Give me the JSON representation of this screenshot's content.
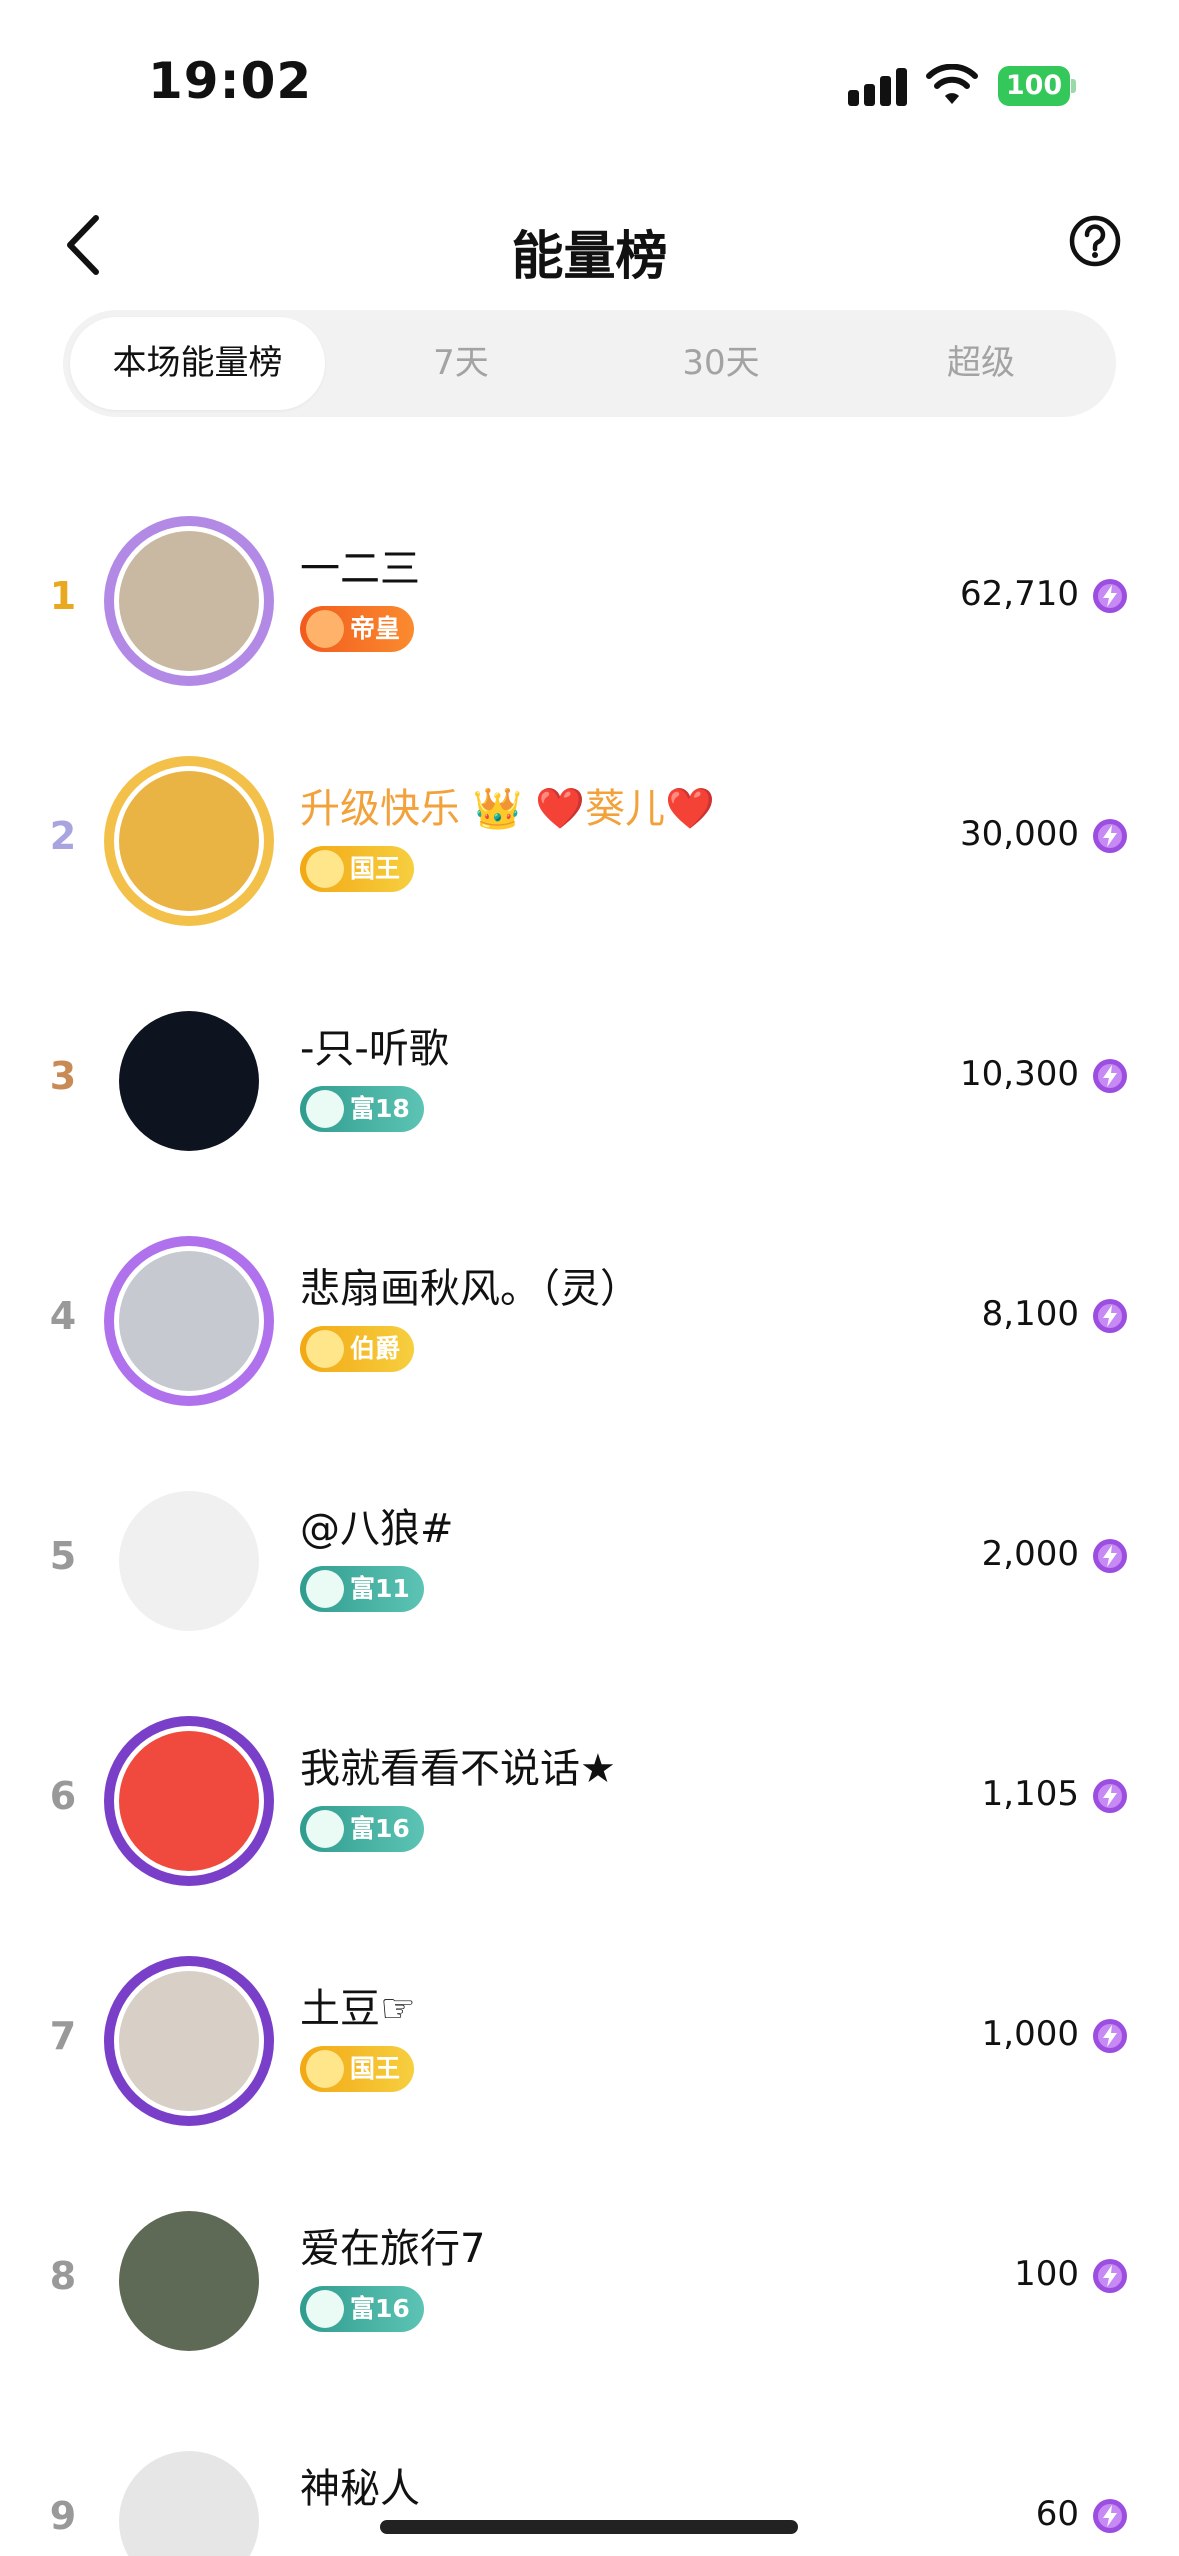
{
  "status_bar": {
    "time": "19:02",
    "battery": "100"
  },
  "nav": {
    "title": "能量榜"
  },
  "tabs": [
    {
      "label": "本场能量榜",
      "active": true
    },
    {
      "label": "7天",
      "active": false
    },
    {
      "label": "30天",
      "active": false
    },
    {
      "label": "超级",
      "active": false
    }
  ],
  "rows": [
    {
      "rank": "1",
      "rank_color": "#e8a920",
      "name": "一二三",
      "badge": "帝皇",
      "badge_style": "orange",
      "score": "62,710",
      "avatar_color": "#c9b9a2",
      "frame_color": "#b28ae6"
    },
    {
      "rank": "2",
      "rank_color": "#a8a4e0",
      "name": "升级快乐 👑 ❤️葵儿❤️",
      "name_color": "#f3a23b",
      "badge": "国王",
      "badge_style": "gold",
      "score": "30,000",
      "avatar_color": "#e9b443",
      "frame_color": "#f3c04a"
    },
    {
      "rank": "3",
      "rank_color": "#c98b55",
      "name": "-只-听歌",
      "badge": "富18",
      "badge_style": "teal",
      "score": "10,300",
      "avatar_color": "#0e1320",
      "frame_color": "transparent"
    },
    {
      "rank": "4",
      "rank_color": "#999999",
      "name": "悲扇画秋风。（灵）",
      "badge": "伯爵",
      "badge_style": "gold",
      "score": "8,100",
      "avatar_color": "#c7c9d1",
      "frame_color": "#b071ec"
    },
    {
      "rank": "5",
      "rank_color": "#999999",
      "name": "@八狼#",
      "badge": "富11",
      "badge_style": "teal",
      "score": "2,000",
      "avatar_color": "#f0f0f0",
      "frame_color": "transparent"
    },
    {
      "rank": "6",
      "rank_color": "#999999",
      "name": "我就看看不说话★",
      "badge": "富16",
      "badge_style": "teal",
      "score": "1,105",
      "avatar_color": "#f04a3e",
      "frame_color": "#7a3fc8"
    },
    {
      "rank": "7",
      "rank_color": "#999999",
      "name": "土豆☞",
      "badge": "国王",
      "badge_style": "gold",
      "score": "1,000",
      "avatar_color": "#d8cfc6",
      "frame_color": "#7a3fc8"
    },
    {
      "rank": "8",
      "rank_color": "#999999",
      "name": "爱在旅行7",
      "badge": "富16",
      "badge_style": "teal",
      "score": "100",
      "avatar_color": "#5e6a55",
      "frame_color": "transparent"
    },
    {
      "rank": "9",
      "rank_color": "#999999",
      "name": "神秘人",
      "badge": "",
      "badge_style": "",
      "score": "60",
      "avatar_color": "#e6e6e6",
      "frame_color": "transparent"
    }
  ]
}
